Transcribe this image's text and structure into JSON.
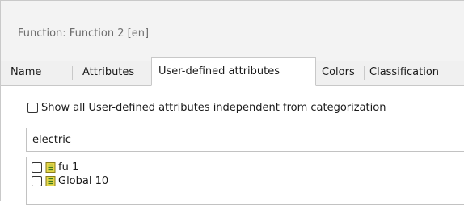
{
  "window": {
    "title": "Function: Function 2  [en]"
  },
  "tabs": [
    {
      "label": "Name",
      "active": false
    },
    {
      "label": "Attributes",
      "active": false
    },
    {
      "label": "User-defined attributes",
      "active": true
    },
    {
      "label": "Colors",
      "active": false
    },
    {
      "label": "Classification",
      "active": false
    }
  ],
  "options": {
    "show_all_label": "Show all User-defined attributes independent from categorization",
    "show_all_checked": false
  },
  "filter": {
    "value": "electric"
  },
  "attribute_list": {
    "items": [
      {
        "label": "fu 1",
        "checked": false,
        "icon": "attribute-icon"
      },
      {
        "label": "Global 10",
        "checked": false,
        "icon": "attribute-icon"
      }
    ]
  },
  "colors": {
    "icon_fill": "#e6d84a",
    "icon_border": "#8a7d1a",
    "icon_lines": "#3f7a1f"
  }
}
